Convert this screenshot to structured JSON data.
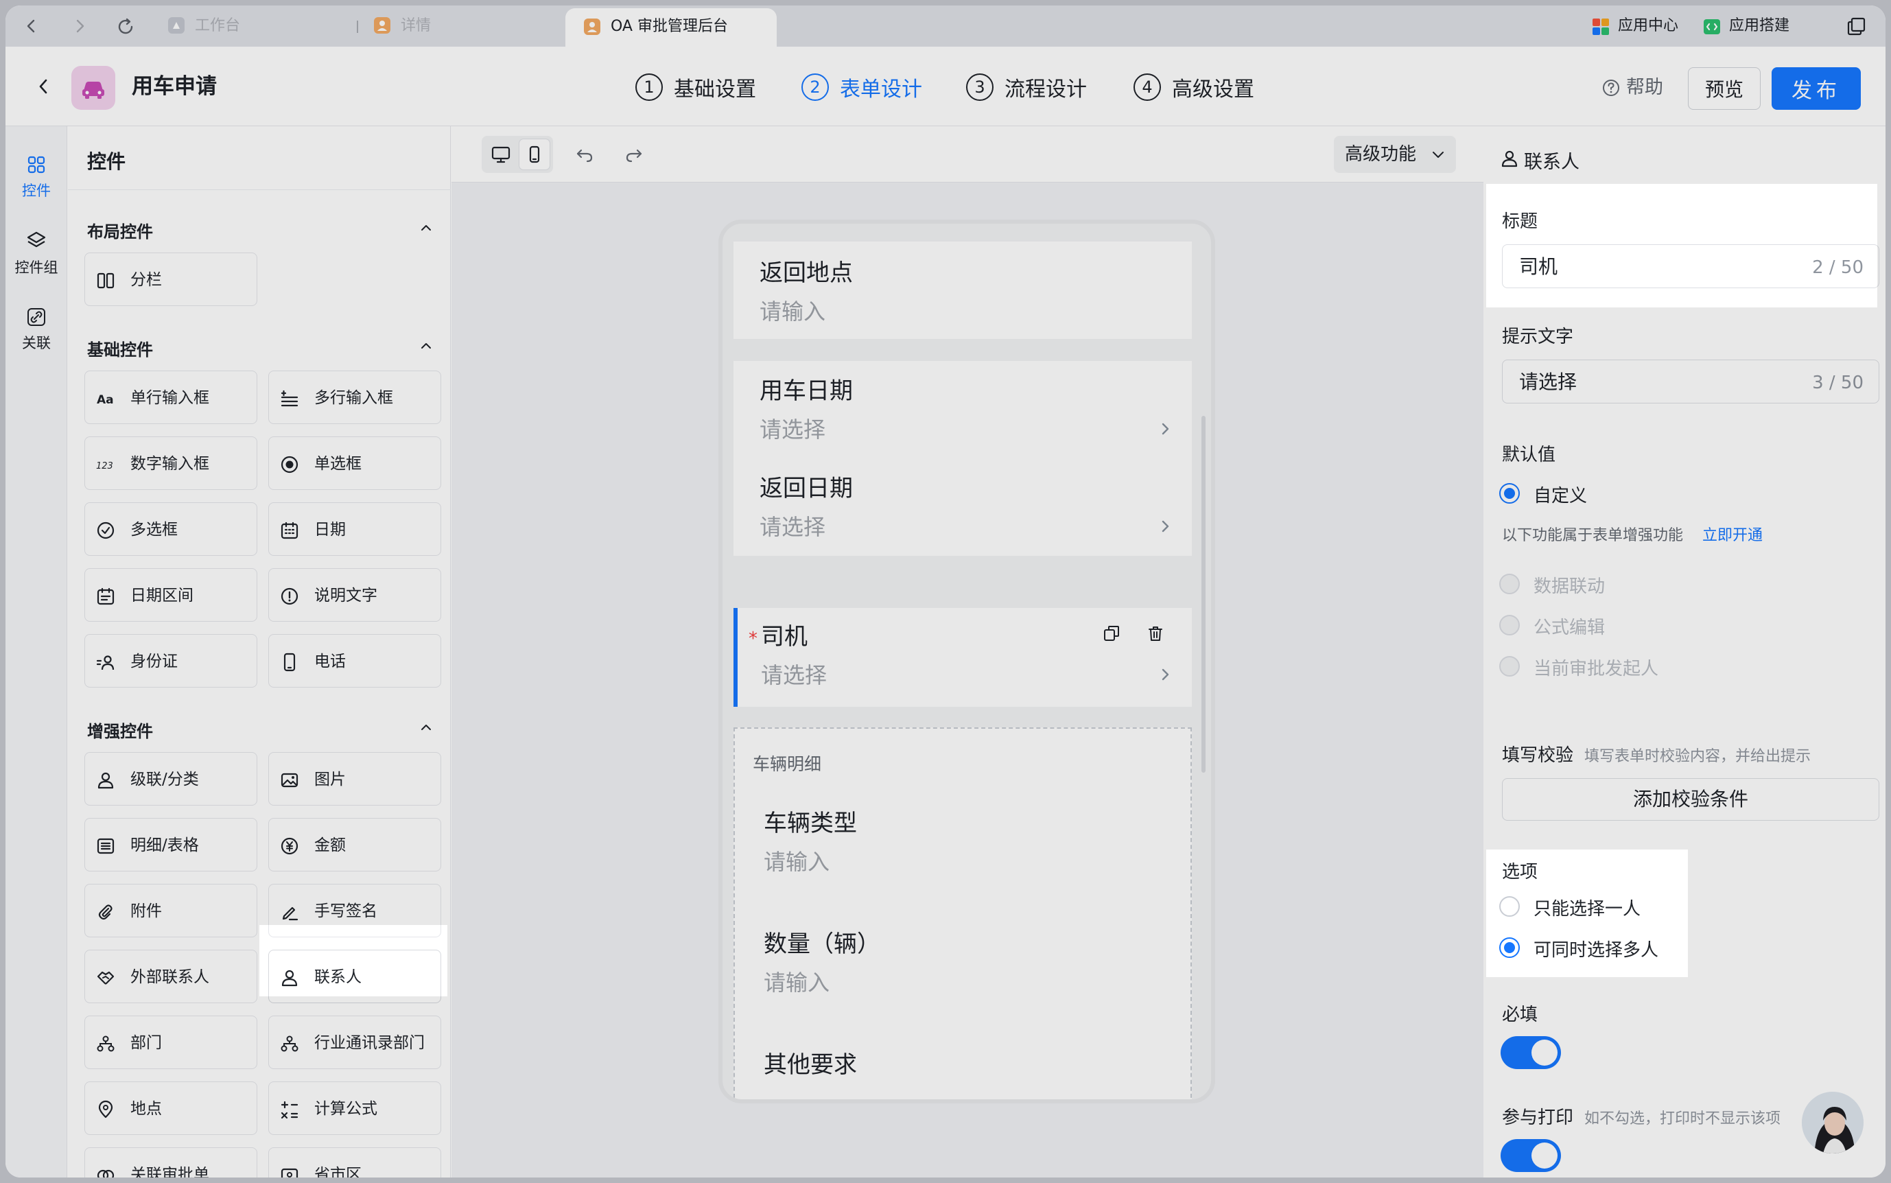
{
  "browser": {
    "tabs": [
      "工作台",
      "详情",
      "OA 审批管理后台"
    ],
    "app_center": "应用中心",
    "app_builder": "应用搭建"
  },
  "header": {
    "title": "用车申请",
    "steps": [
      {
        "num": "1",
        "label": "基础设置"
      },
      {
        "num": "2",
        "label": "表单设计"
      },
      {
        "num": "3",
        "label": "流程设计"
      },
      {
        "num": "4",
        "label": "高级设置"
      }
    ],
    "help": "帮助",
    "preview": "预览",
    "publish": "发布"
  },
  "rail": {
    "items": [
      "控件",
      "控件组",
      "关联"
    ]
  },
  "controls": {
    "title": "控件",
    "layout_section": "布局控件",
    "layout_items": [
      "分栏"
    ],
    "basic_section": "基础控件",
    "basic_items": [
      "单行输入框",
      "多行输入框",
      "数字输入框",
      "单选框",
      "多选框",
      "日期",
      "日期区间",
      "说明文字",
      "身份证",
      "电话"
    ],
    "enhanced_section": "增强控件",
    "enhanced_items": [
      "级联/分类",
      "图片",
      "明细/表格",
      "金额",
      "附件",
      "手写签名",
      "外部联系人",
      "联系人",
      "部门",
      "行业通讯录部门",
      "地点",
      "计算公式",
      "关联审批单",
      "省市区"
    ]
  },
  "canvas": {
    "advanced": "高级功能",
    "fields": [
      {
        "label": "返回地点",
        "placeholder": "请输入"
      },
      {
        "label": "用车日期",
        "placeholder": "请选择"
      },
      {
        "label": "返回日期",
        "placeholder": "请选择"
      },
      {
        "label": "司机",
        "placeholder": "请选择",
        "required_mark": "*"
      }
    ],
    "detail_group": "车辆明细",
    "detail_fields": [
      {
        "label": "车辆类型",
        "placeholder": "请输入"
      },
      {
        "label": "数量（辆）",
        "placeholder": "请输入"
      },
      {
        "label": "其他要求",
        "placeholder": ""
      }
    ]
  },
  "props": {
    "header": "联系人",
    "title_label": "标题",
    "title_value": "司机",
    "title_count": "2 / 50",
    "hint_label": "提示文字",
    "hint_value": "请选择",
    "hint_count": "3 / 50",
    "default_label": "默认值",
    "default_option": "自定义",
    "enhance_note": "以下功能属于表单增强功能",
    "enhance_link": "立即开通",
    "disabled_options": [
      "数据联动",
      "公式编辑",
      "当前审批发起人"
    ],
    "validate_label": "填写校验",
    "validate_note": "填写表单时校验内容，并给出提示",
    "validate_button": "添加校验条件",
    "options_label": "选项",
    "option_single": "只能选择一人",
    "option_multi": "可同时选择多人",
    "required_label": "必填",
    "required_on": true,
    "print_label": "参与打印",
    "print_note": "如不勾选，打印时不显示该项",
    "print_on": true
  },
  "colors": {
    "accent": "#1677ff",
    "required": "#f53f3f",
    "app_icon_bg": "#f3d3ee"
  }
}
